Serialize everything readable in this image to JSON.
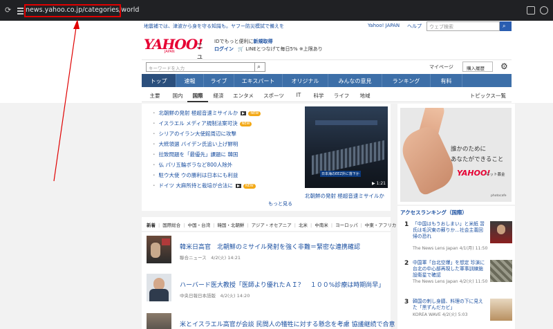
{
  "browser": {
    "url": "news.yahoo.co.jp/categories/world"
  },
  "header": {
    "notice": "地震補では、津波から身を守る知識も。ヤフー防災模試で備えを",
    "yahoo_japan": "Yahoo! JAPAN",
    "help": "ヘルプ",
    "web_search_placeholder": "ウェブ検索",
    "logo_text": "YAHOO!",
    "logo_sub": "JAPAN",
    "logo_news": "ニュース",
    "promo_line1_prefix": "IDでもっと便利に",
    "promo_line1_link": "新規取得",
    "promo_login": "ログイン",
    "promo_line2": "LINEとつなげて毎日5% ※上限あり",
    "keyword_placeholder": "キーワードを入力",
    "mypage": "マイページ",
    "history": "購入履歴"
  },
  "main_nav": [
    "トップ",
    "速報",
    "ライブ",
    "エキスパート",
    "オリジナル",
    "みんなの意見",
    "ランキング",
    "有料"
  ],
  "sub_nav": [
    "主要",
    "国内",
    "国際",
    "経済",
    "エンタメ",
    "スポーツ",
    "IT",
    "科学",
    "ライフ",
    "地域"
  ],
  "sub_nav_right": "トピックス一覧",
  "headlines": [
    {
      "text": "北朝鮮の発射 極超音速ミサイルか",
      "video": true,
      "new": true
    },
    {
      "text": "イスラエル メディア規制法案可決",
      "video": false,
      "new": true
    },
    {
      "text": "シリアのイラン大使館周辺に攻撃",
      "video": false,
      "new": false
    },
    {
      "text": "大統領選 バイデン氏追い上げ鮮明",
      "video": false,
      "new": false
    },
    {
      "text": "拉致問題を「最優先」課題に 韓国",
      "video": false,
      "new": false
    },
    {
      "text": "仏 パリ五輪ボラなど800人除外",
      "video": false,
      "new": false
    },
    {
      "text": "駐ウ大使 ウの勝利は日本にも利益",
      "video": false,
      "new": false
    },
    {
      "text": "ドイツ 大麻所持と栽培が合法に",
      "video": true,
      "new": true
    }
  ],
  "new_badge": "NEW",
  "more_label": "もっと見る",
  "feature": {
    "image_caption": "日本海のEEZ外に落下か",
    "duration": "1:21",
    "title": "北朝鮮の発射 極超音速ミサイルか"
  },
  "category_nav": [
    "新着",
    "国際総合",
    "中国・台湾",
    "韓国・北朝鮮",
    "アジア・オセアニア",
    "北米",
    "中南米",
    "ヨーロッパ",
    "中東・アフリカ"
  ],
  "articles": [
    {
      "title": "韓米日高官　北朝鮮のミサイル発射を強く非難＝緊密な連携確認",
      "meta": "聯合ニュース　4/2(火) 14:21"
    },
    {
      "title": "ハーバード医大教授「医師より優れたＡＩ？　１００%診療は時期尚早」",
      "meta": "中央日報日本語版　4/2(火) 14:20"
    },
    {
      "title": "米とイスラエル高官が会談 民間人の犠牲に対する懸念を考慮 協議継続で合意",
      "meta": ""
    }
  ],
  "ad": {
    "line1": "誰かのために",
    "line2": "あなたができること",
    "logo": "YAHOO!",
    "logo_sub": "JAPAN",
    "bokin": "ネット募金",
    "credit": "photocafe"
  },
  "ranking": {
    "title": "アクセスランキング（国際）",
    "items": [
      {
        "num": "1",
        "text": "「中国はもうおしまい」と米紙 習氏は毛沢東の蘇りか…社会主義回帰の恐れ",
        "meta": "The News Lens Japan 4/1(月) 11:50"
      },
      {
        "num": "2",
        "text": "中国軍「台北空爆」を想定 珍演に台北の中心部再現した軍事訓練施設衛星で確認",
        "meta": "The News Lens Japan 4/2(火) 11:50"
      },
      {
        "num": "3",
        "text": "韓国の刺し身膳、料理の下に見えた「黒ずんだカビ」",
        "meta": "KOREA WAVE 4/2(火) 5:03"
      }
    ]
  },
  "colors": {
    "nav_blue": "#3d6fa8",
    "link_blue": "#1a4fa0",
    "yahoo_red": "#e60033",
    "annotation_red": "#e00000"
  }
}
